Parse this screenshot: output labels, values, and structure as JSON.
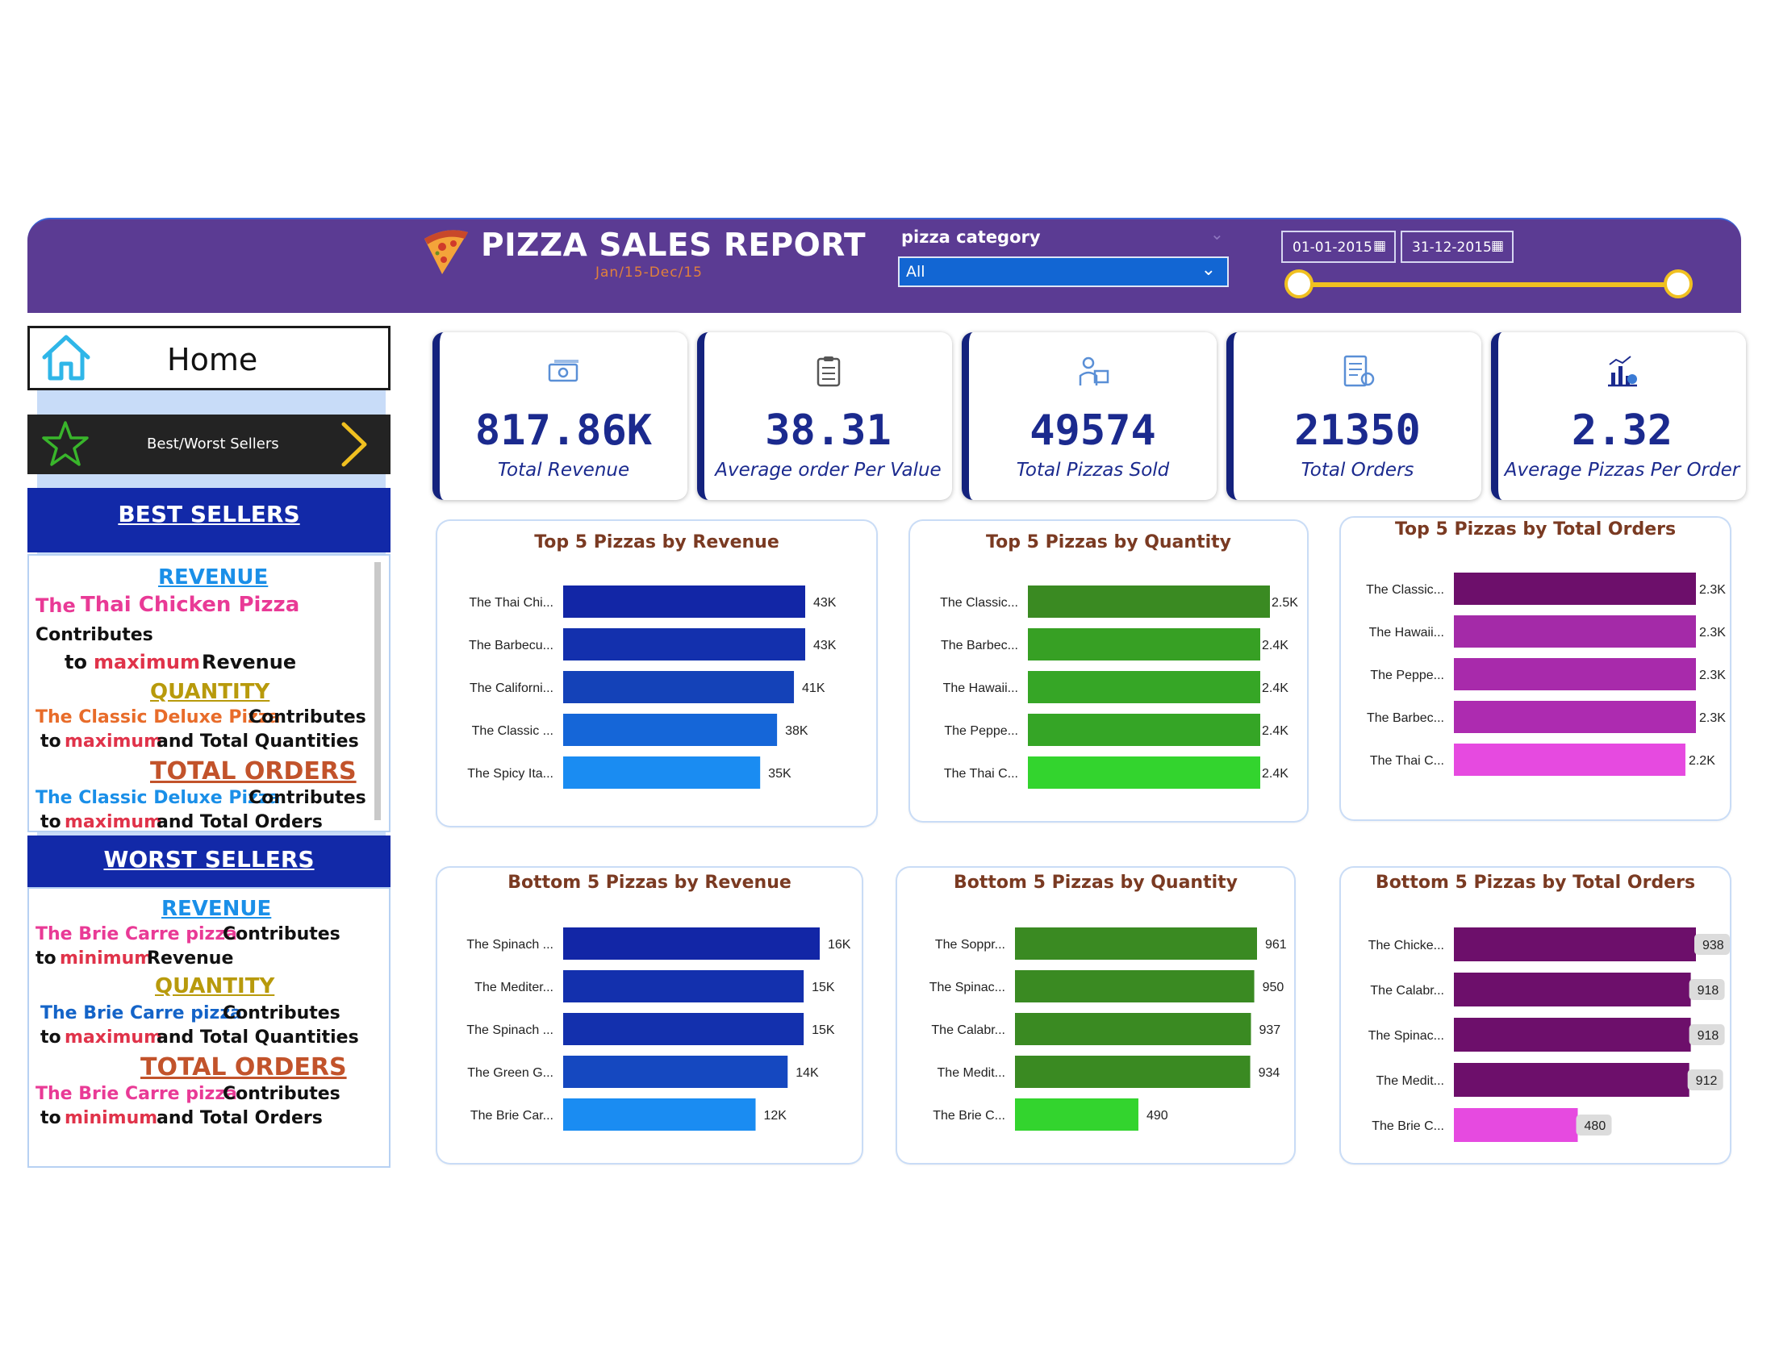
{
  "header": {
    "title": "PIZZA SALES REPORT",
    "subtitle": "Jan/15-Dec/15",
    "category_label": "pizza category",
    "category_value": "All",
    "date_start": "01-01-2015",
    "date_end": "31-12-2015"
  },
  "nav": {
    "home_label": "Home",
    "best_worst_label": "Best/Worst Sellers"
  },
  "best_sellers": {
    "title": "BEST SELLERS",
    "revenue": {
      "head": "REVENUE",
      "the": "The",
      "pizza": "Thai Chicken Pizza",
      "contributes": "Contributes",
      "to": "to",
      "extreme": "maximum",
      "measure": "Revenue"
    },
    "quantity": {
      "head": "QUANTITY",
      "pizza": "The Classic Deluxe Pizza",
      "contributes": "Contributes",
      "to": "to",
      "extreme": "maximum",
      "measure": "and Total Quantities"
    },
    "orders": {
      "head": "TOTAL ORDERS",
      "pizza": "The Classic Deluxe Pizza",
      "contributes": "Contributes",
      "to": "to",
      "extreme": "maximum",
      "measure": "and Total Orders"
    }
  },
  "worst_sellers": {
    "title": "WORST SELLERS",
    "revenue": {
      "head": "REVENUE",
      "pizza": "The Brie Carre  pizza",
      "contributes": "Contributes",
      "to": "to",
      "extreme": "minimum",
      "measure": "Revenue"
    },
    "quantity": {
      "head": "QUANTITY",
      "pizza": "The Brie Carre  pizza",
      "contributes": "Contributes",
      "to": "to",
      "extreme": "maximum",
      "measure": "and Total Quantities"
    },
    "orders": {
      "head": "TOTAL ORDERS",
      "pizza": "The Brie Carre  pizza",
      "contributes": "Contributes",
      "to": "to",
      "extreme": "minimum",
      "measure": "and Total Orders"
    }
  },
  "kpis": [
    {
      "value": "817.86K",
      "label": "Total Revenue",
      "icon": "money-icon"
    },
    {
      "value": "38.31",
      "label": "Average order Per Value",
      "icon": "clipboard-icon"
    },
    {
      "value": "49574",
      "label": "Total Pizzas Sold",
      "icon": "delivery-icon"
    },
    {
      "value": "21350",
      "label": "Total Orders",
      "icon": "order-list-icon"
    },
    {
      "value": "2.32",
      "label": "Average Pizzas Per Order",
      "icon": "chart-coin-icon"
    }
  ],
  "chart_data": [
    {
      "type": "bar",
      "title": "Top 5 Pizzas by Revenue",
      "categories": [
        "The Thai Chi...",
        "The Barbecu...",
        "The Californi...",
        "The Classic ...",
        "The Spicy Ita..."
      ],
      "values": [
        43000,
        43000,
        41000,
        38000,
        35000
      ],
      "labels": [
        "43K",
        "43K",
        "41K",
        "38K",
        "35K"
      ],
      "colors": [
        "#1226a6",
        "#1330ad",
        "#1442b8",
        "#1566d8",
        "#1a8cf2"
      ]
    },
    {
      "type": "bar",
      "title": "Top 5 Pizzas by Quantity",
      "categories": [
        "The Classic...",
        "The Barbec...",
        "The Hawaii...",
        "The Peppe...",
        "The Thai C..."
      ],
      "values": [
        2500,
        2400,
        2400,
        2400,
        2400
      ],
      "labels": [
        "2.5K",
        "2.4K",
        "2.4K",
        "2.4K",
        "2.4K"
      ],
      "colors": [
        "#3a8a22",
        "#37a024",
        "#36a626",
        "#35a526",
        "#33d42e"
      ]
    },
    {
      "type": "bar",
      "title": "Top 5 Pizzas by Total Orders",
      "categories": [
        "The Classic...",
        "The Hawaii...",
        "The Peppe...",
        "The Barbec...",
        "The Thai C..."
      ],
      "values": [
        2300,
        2300,
        2300,
        2300,
        2200
      ],
      "labels": [
        "2.3K",
        "2.3K",
        "2.3K",
        "2.3K",
        "2.2K"
      ],
      "colors": [
        "#6d0f6b",
        "#a42aa8",
        "#a82aab",
        "#ad2bb0",
        "#e64ae0"
      ]
    },
    {
      "type": "bar",
      "title": "Bottom 5 Pizzas by Revenue",
      "categories": [
        "The Spinach ...",
        "The Mediter...",
        "The Spinach ...",
        "The Green G...",
        "The Brie Car..."
      ],
      "values": [
        16000,
        15000,
        15000,
        14000,
        12000
      ],
      "labels": [
        "16K",
        "15K",
        "15K",
        "14K",
        "12K"
      ],
      "colors": [
        "#1226a6",
        "#1330ad",
        "#1330ad",
        "#1548c0",
        "#1a8cf2"
      ]
    },
    {
      "type": "bar",
      "title": "Bottom 5 Pizzas by Quantity",
      "categories": [
        "The Soppr...",
        "The Spinac...",
        "The Calabr...",
        "The Medit...",
        "The Brie C..."
      ],
      "values": [
        961,
        950,
        937,
        934,
        490
      ],
      "labels": [
        "961",
        "950",
        "937",
        "934",
        "490"
      ],
      "colors": [
        "#3a8a22",
        "#3a8a22",
        "#3a8a22",
        "#3a8a22",
        "#33d42e"
      ]
    },
    {
      "type": "bar",
      "title": "Bottom 5 Pizzas by Total Orders",
      "categories": [
        "The Chicke...",
        "The Calabr...",
        "The Spinac...",
        "The Medit...",
        "The Brie C..."
      ],
      "values": [
        938,
        918,
        918,
        912,
        480
      ],
      "labels": [
        "938",
        "918",
        "918",
        "912",
        "480"
      ],
      "colors": [
        "#6d0f6b",
        "#6d0f6b",
        "#6d0f6b",
        "#6d0f6b",
        "#e64ae0"
      ]
    }
  ]
}
